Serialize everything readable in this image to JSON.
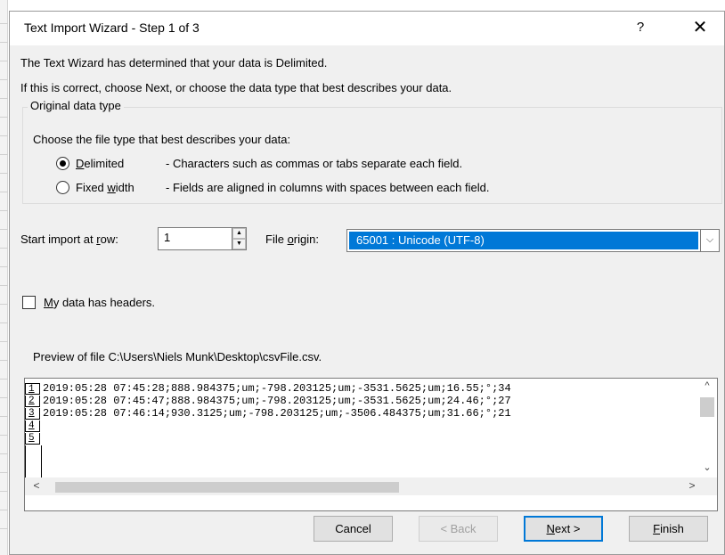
{
  "title": "Text Import Wizard - Step 1 of 3",
  "titlebar": {
    "help": "?",
    "close": "✕"
  },
  "intro": {
    "line1": "The Text Wizard has determined that your data is Delimited.",
    "line2": "If this is correct, choose Next, or choose the data type that best describes your data."
  },
  "original_data_type": {
    "legend": "Original data type",
    "prompt": "Choose the file type that best describes your data:",
    "options": [
      {
        "label_first": "D",
        "label_rest": "elimited",
        "description": "- Characters such as commas or tabs separate each field.",
        "checked": true
      },
      {
        "label_pre": "Fixed ",
        "label_ul": "w",
        "label_post": "idth",
        "description": "- Fields are aligned in columns with spaces between each field.",
        "checked": false
      }
    ]
  },
  "start_row": {
    "label_pre": "Start import at ",
    "label_ul": "r",
    "label_post": "ow:",
    "value": "1",
    "up": "▲",
    "down": "▼"
  },
  "file_origin": {
    "label_pre": "File ",
    "label_ul": "o",
    "label_post": "rigin:",
    "value": "65001 : Unicode (UTF-8)",
    "arrow": "⌵"
  },
  "headers_checkbox": {
    "label_ul": "M",
    "label_post": "y data has headers.",
    "checked": false
  },
  "preview": {
    "caption": "Preview of file C:\\Users\\Niels Munk\\Desktop\\csvFile.csv.",
    "rows": [
      {
        "num": "1",
        "text": "2019:05:28 07:45:28;888.984375;um;-798.203125;um;-3531.5625;um;16.55;°;34"
      },
      {
        "num": "2",
        "text": "2019:05:28 07:45:47;888.984375;um;-798.203125;um;-3531.5625;um;24.46;°;27"
      },
      {
        "num": "3",
        "text": "2019:05:28 07:46:14;930.3125;um;-798.203125;um;-3506.484375;um;31.66;°;21"
      },
      {
        "num": "4",
        "text": ""
      },
      {
        "num": "5",
        "text": ""
      }
    ],
    "scroll": {
      "up": "^",
      "down": "⌄",
      "left": "<",
      "right": ">"
    }
  },
  "buttons": {
    "cancel": "Cancel",
    "back": "< Back",
    "next_ul": "N",
    "next_rest": "ext >",
    "finish_ul": "F",
    "finish_rest": "inish"
  }
}
